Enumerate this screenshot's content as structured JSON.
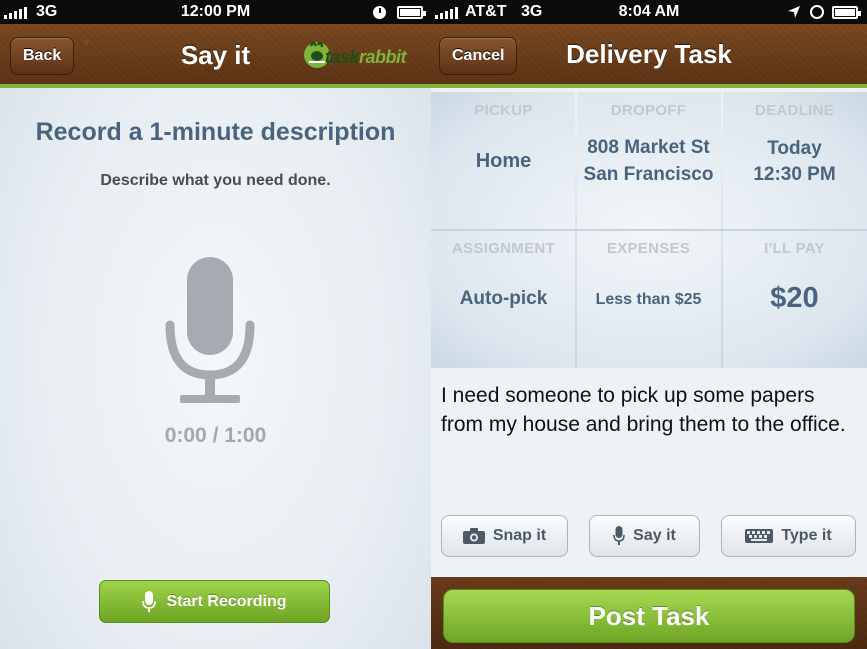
{
  "left_screen": {
    "status": {
      "carrier": "3G",
      "time": "12:00 PM"
    },
    "nav": {
      "back_label": "Back",
      "title": "Say it",
      "logo_text_a": "task",
      "logo_text_b": "rabbit"
    },
    "heading": "Record a 1-minute description",
    "subheading": "Describe what you need done.",
    "timer": "0:00 / 1:00",
    "record_button": "Start Recording"
  },
  "right_screen": {
    "status": {
      "carrier": "AT&T",
      "network": "3G",
      "time": "8:04 AM"
    },
    "nav": {
      "cancel_label": "Cancel",
      "title": "Delivery Task"
    },
    "fields": [
      {
        "label": "PICKUP",
        "value_line1": "Home",
        "value_line2": ""
      },
      {
        "label": "DROPOFF",
        "value_line1": "808 Market St",
        "value_line2": "San Francisco"
      },
      {
        "label": "DEADLINE",
        "value_line1": "Today",
        "value_line2": "12:30 PM"
      },
      {
        "label": "ASSIGNMENT",
        "value_line1": "Auto-pick",
        "value_line2": ""
      },
      {
        "label": "EXPENSES",
        "value_line1": "Less than $25",
        "value_line2": ""
      },
      {
        "label": "I'LL PAY",
        "value_line1": "$20",
        "value_line2": ""
      }
    ],
    "description": "I need someone to pick up some papers from my house and bring them to the office.",
    "actions": {
      "snap": "Snap it",
      "say": "Say it",
      "type": "Type it"
    },
    "post_button": "Post Task"
  },
  "colors": {
    "accent_green": "#7fb33a",
    "heading_blue": "#4a6480",
    "nav_brown": "#6a3c1b"
  },
  "icons": [
    "signal-icon",
    "battery-icon",
    "clock-icon",
    "location-arrow-icon",
    "lock-rotation-icon",
    "microphone-icon",
    "camera-icon",
    "keyboard-icon",
    "taskrabbit-logo-icon"
  ]
}
